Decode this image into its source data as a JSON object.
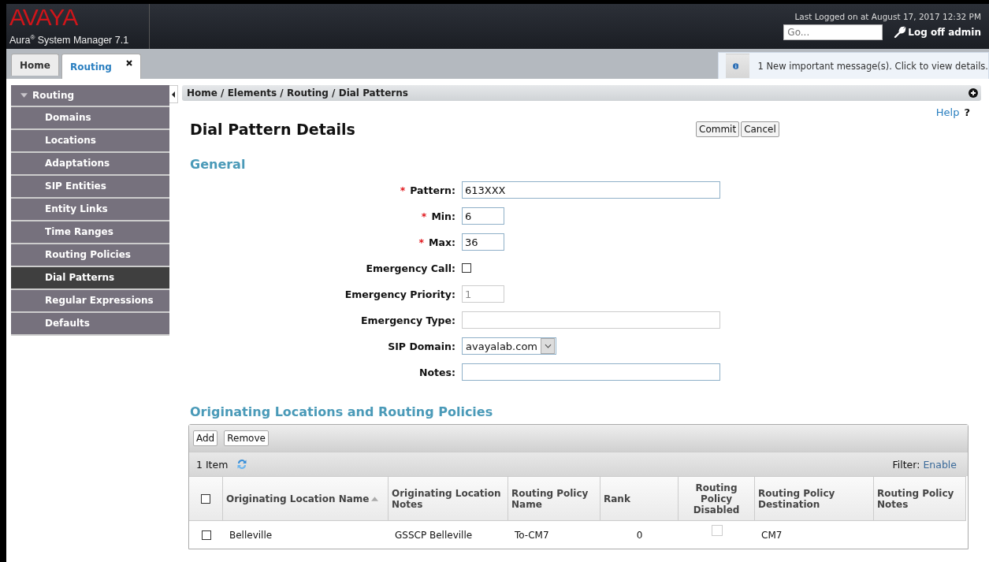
{
  "header": {
    "logo": "AVAYA",
    "product": "Aura$^{®}$ System Manager 7.1",
    "last_login": "Last Logged on at August 17, 2017 12:32 PM",
    "search": {
      "placeholder": "Go..."
    },
    "logoff": "Log off admin"
  },
  "tabs": [
    {
      "label": "Home",
      "selected": false,
      "closable": false
    },
    {
      "label": "Routing",
      "selected": true,
      "closable": true
    }
  ],
  "message": "1 New important message(s). Click to view details.",
  "sidebar": {
    "title": "Routing",
    "expanded": true,
    "items": [
      {
        "label": "Domains",
        "selected": false
      },
      {
        "label": "Locations",
        "selected": false
      },
      {
        "label": "Adaptations",
        "selected": false
      },
      {
        "label": "SIP Entities",
        "selected": false
      },
      {
        "label": "Entity Links",
        "selected": false
      },
      {
        "label": "Time Ranges",
        "selected": false
      },
      {
        "label": "Routing Policies",
        "selected": false
      },
      {
        "label": "Dial Patterns",
        "selected": true
      },
      {
        "label": "Regular Expressions",
        "selected": false
      },
      {
        "label": "Defaults",
        "selected": false
      }
    ]
  },
  "breadcrumb": "Home / Elements / Routing / Dial Patterns",
  "help": {
    "label": "Help",
    "mark": "?"
  },
  "page_title": "Dial Pattern Details",
  "buttons": [
    "Commit",
    "Cancel"
  ],
  "general": {
    "heading": "General",
    "fields": [
      {
        "label": "Pattern:",
        "required_mark": "*",
        "kind": "text",
        "value": "613XXX",
        "disabled": false
      },
      {
        "label": "Min:",
        "required_mark": "*",
        "kind": "short",
        "value": "6",
        "disabled": false
      },
      {
        "label": "Max:",
        "required_mark": "*",
        "kind": "short",
        "value": "36",
        "disabled": false
      },
      {
        "label": "Emergency Call:",
        "kind": "checkbox",
        "checked": false
      },
      {
        "label": "Emergency Priority:",
        "kind": "short",
        "value": "1",
        "disabled": true
      },
      {
        "label": "Emergency Type:",
        "kind": "text",
        "disabled": true
      },
      {
        "label": "SIP Domain:",
        "kind": "select",
        "value": "avayalab.com"
      },
      {
        "label": "Notes:",
        "kind": "text",
        "disabled": false
      }
    ]
  },
  "policies": {
    "heading": "Originating Locations and Routing Policies",
    "toolbar": [
      "Add",
      "Remove"
    ],
    "count": "1 Item",
    "filter_label": "Filter:",
    "filter_link": "Enable",
    "all_selected": false,
    "columns": [
      {
        "label": "Originating Location Name",
        "sorted": true
      },
      {
        "label": "Originating Location Notes",
        "sorted": false
      },
      {
        "label": "Routing Policy Name",
        "sorted": false
      },
      {
        "label": "Rank",
        "sorted": false
      },
      {
        "label": "Routing Policy Disabled",
        "sorted": false
      },
      {
        "label": "Routing Policy Destination",
        "sorted": false
      },
      {
        "label": "Routing Policy Notes",
        "sorted": false
      }
    ],
    "rows": [
      {
        "selected": false,
        "location": "Belleville",
        "location_notes": "GSSCP Belleville",
        "policy_name": "To-CM7",
        "rank": "0",
        "policy_disabled": false,
        "destination": "CM7"
      }
    ]
  }
}
